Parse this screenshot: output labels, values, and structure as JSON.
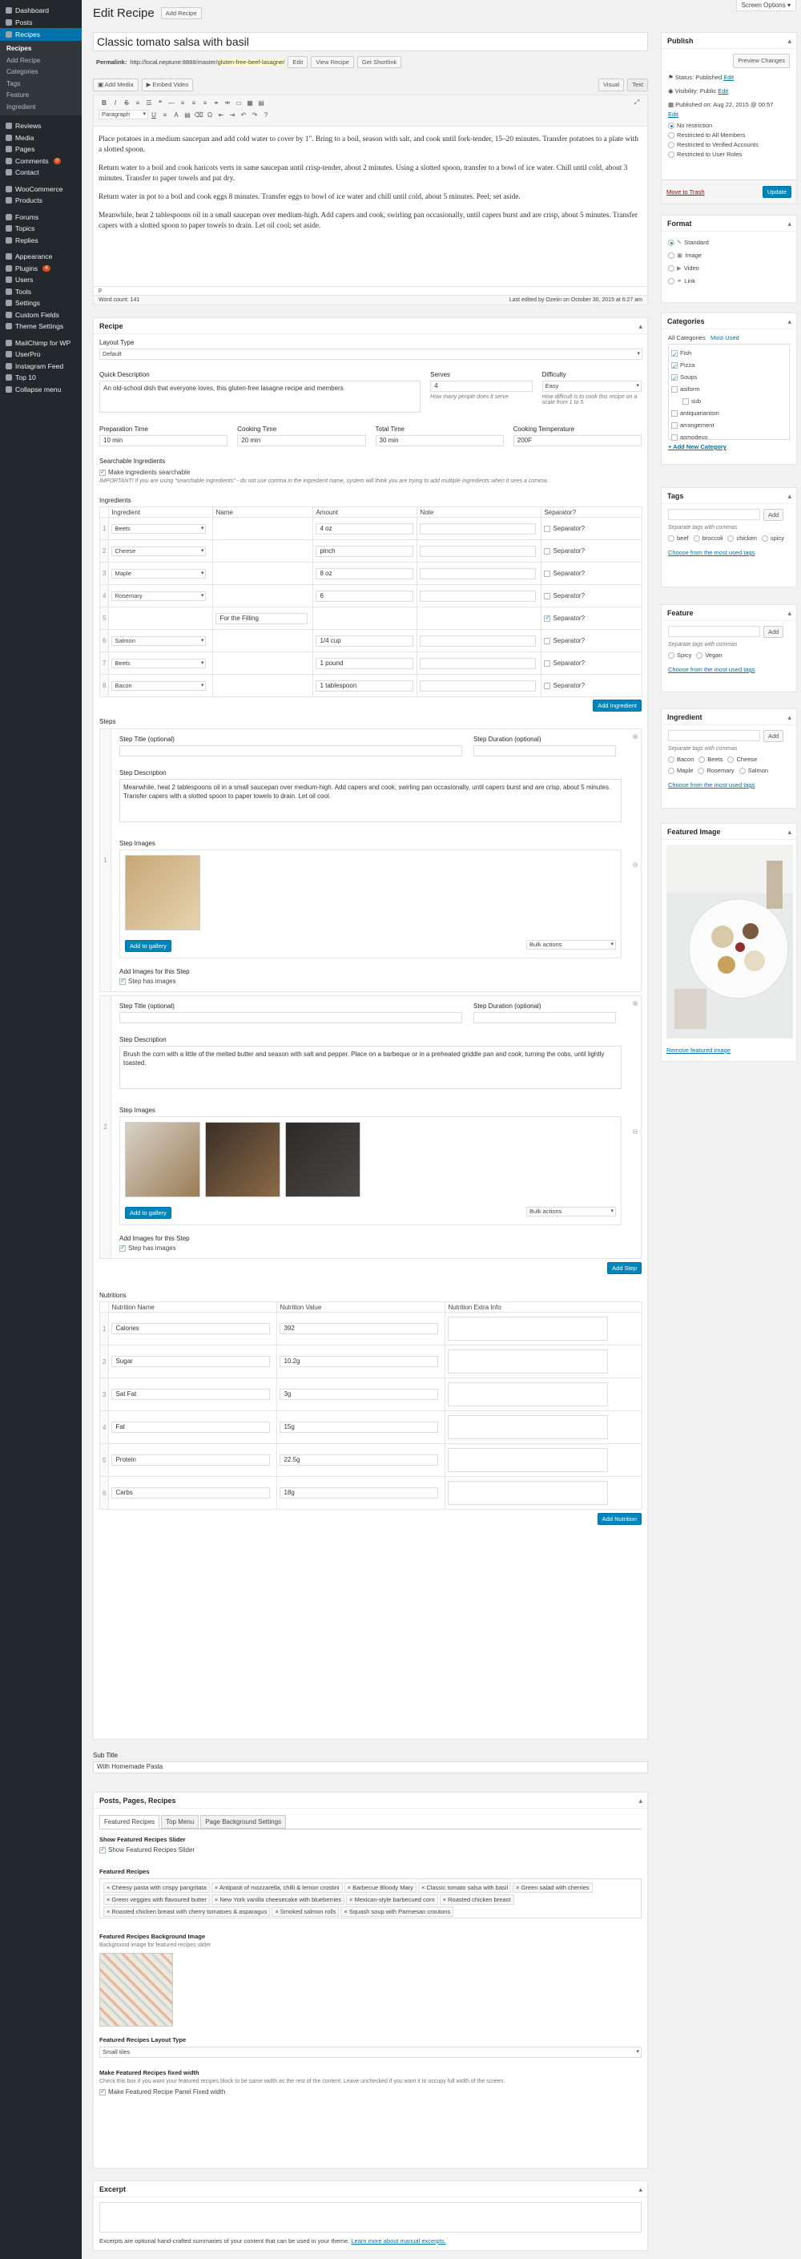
{
  "admin_menu": {
    "items": [
      {
        "label": "Dashboard",
        "icon": "dashboard-icon"
      },
      {
        "label": "Posts",
        "icon": "posts-icon"
      },
      {
        "label": "Recipes",
        "icon": "recipes-icon"
      }
    ],
    "recipes_sub": [
      "Recipes",
      "Add Recipe",
      "Categories",
      "Tags",
      "Feature",
      "Ingredient"
    ],
    "items2": [
      {
        "label": "Reviews"
      },
      {
        "label": "Media"
      },
      {
        "label": "Pages"
      },
      {
        "label": "Comments",
        "badge": "0"
      },
      {
        "label": "Contact"
      }
    ],
    "items3": [
      {
        "label": "WooCommerce"
      },
      {
        "label": "Products"
      }
    ],
    "items4": [
      {
        "label": "Forums"
      },
      {
        "label": "Topics"
      },
      {
        "label": "Replies"
      }
    ],
    "items5": [
      {
        "label": "Appearance"
      },
      {
        "label": "Plugins",
        "badge": "4"
      },
      {
        "label": "Users"
      },
      {
        "label": "Tools"
      },
      {
        "label": "Settings"
      },
      {
        "label": "Custom Fields"
      },
      {
        "label": "Theme Settings"
      }
    ],
    "items6": [
      {
        "label": "MailChimp for WP"
      },
      {
        "label": "UserPro"
      },
      {
        "label": "Instagram Feed"
      },
      {
        "label": "Top 10"
      },
      {
        "label": "Collapse menu"
      }
    ]
  },
  "screen_options": "Screen Options ▾",
  "header": {
    "title": "Edit Recipe",
    "add_btn": "Add Recipe"
  },
  "post": {
    "title": "Classic tomato salsa with basil",
    "permalink_label": "Permalink:",
    "permalink_base": "http://local.neptune:8888/master/",
    "permalink_slug": "gluten-free-beef-lasagne/",
    "edit_btn": "Edit",
    "view_btn": "View Recipe",
    "shortlink_btn": "Get Shortlink"
  },
  "editor": {
    "add_media": "Add Media",
    "embed_video": "Embed Video",
    "visual_tab": "Visual",
    "text_tab": "Text",
    "format_select": "Paragraph",
    "paragraphs": [
      "Place potatoes in a medium saucepan and add cold water to cover by 1\". Bring to a boil, season with salt, and cook until fork-tender, 15–20 minutes. Transfer potatoes to a plate with a slotted spoon.",
      "Return water to a boil and cook haricots verts in same saucepan until crisp-tender, about 2 minutes. Using a slotted spoon, transfer to a bowl of ice water. Chill until cold, about 3 minutes. Transfer to paper towels and pat dry.",
      "Return water in pot to a boil and cook eggs 8 minutes. Transfer eggs to bowl of ice water and chill until cold, about 5 minutes. Peel; set aside.",
      "Meanwhile, heat 2 tablespoons oil in a small saucepan over medium-high. Add capers and cook, swirling pan occasionally, until capers burst and are crisp, about 5 minutes. Transfer capers with a slotted spoon to paper towels to drain. Let oil cool; set aside."
    ],
    "path": "p",
    "word_count": "Word count: 141",
    "last_edited": "Last edited by Ozeiin on October 30, 2015 at 6:27 am"
  },
  "recipe": {
    "title": "Recipe",
    "layout_label": "Layout Type",
    "layout_value": "Default",
    "quick_desc_label": "Quick Description",
    "quick_desc_value": "An old-school dish that everyone loves, this gluten-free lasagne recipe and members",
    "serves_label": "Serves",
    "serves_value": "4",
    "serves_help": "How many people does it serve",
    "difficulty_label": "Difficulty",
    "difficulty_value": "Easy",
    "difficulty_help": "How difficult is to cook this recipe on a scale from 1 to 5",
    "prep_label": "Preparation Time",
    "prep_value": "10 min",
    "cook_label": "Cooking Time",
    "cook_value": "20 min",
    "total_label": "Total Time",
    "total_value": "30 min",
    "temp_label": "Cooking Temperature",
    "temp_value": "200F",
    "searchable_label": "Searchable Ingredients",
    "searchable_cb": "Make ingredients searchable",
    "searchable_note": "IMPORTANT! If you are using \"searchable ingredients\" - do not use comma in the ingredient name, system will think you are trying to add multiple ingredients when it sees a comma.",
    "ingredients_label": "Ingredients",
    "ing_cols": [
      "Ingredient",
      "Name",
      "Amount",
      "Note",
      "Separator?"
    ],
    "ingredients": [
      {
        "n": "1",
        "ingredient": "Beets",
        "name": "",
        "amount": "4 oz",
        "note": "",
        "sep": false
      },
      {
        "n": "2",
        "ingredient": "Cheese",
        "name": "",
        "amount": "pinch",
        "note": "",
        "sep": false
      },
      {
        "n": "3",
        "ingredient": "Maple",
        "name": "",
        "amount": "8 oz",
        "note": "",
        "sep": false
      },
      {
        "n": "4",
        "ingredient": "Rosemary",
        "name": "",
        "amount": "6",
        "note": "",
        "sep": false
      },
      {
        "n": "5",
        "ingredient": "",
        "name": "For the Filling",
        "amount": "",
        "note": "",
        "sep": true
      },
      {
        "n": "6",
        "ingredient": "Salmon",
        "name": "",
        "amount": "1/4 cup",
        "note": "",
        "sep": false
      },
      {
        "n": "7",
        "ingredient": "Beets",
        "name": "",
        "amount": "1 pound",
        "note": "",
        "sep": false
      },
      {
        "n": "8",
        "ingredient": "Bacon",
        "name": "",
        "amount": "1 tablespoon",
        "note": "",
        "sep": false
      }
    ],
    "sep_label": "Separator?",
    "add_ingredient": "Add Ingredient",
    "steps_label": "Steps",
    "step_title_label": "Step Title (optional)",
    "step_duration_label": "Step Duration (optional)",
    "step_desc_label": "Step Description",
    "step_images_label": "Step Images",
    "add_gallery": "Add to gallery",
    "bulk_actions": "Bulk actions",
    "add_images_label": "Add Images for this Step",
    "step_has_images": "Step has images",
    "steps": [
      {
        "n": "1",
        "desc": "Meanwhile, heat 2 tablespoons oil in a small saucepan over medium-high. Add capers and cook, swirling pan occasionally, until capers burst and are crisp, about 5 minutes. Transfer capers with a slotted spoon to paper towels to drain. Let oil cool."
      },
      {
        "n": "2",
        "desc": "Brush the corn with a little of the melted butter and season with salt and pepper. Place on a barbeque or in a preheated griddle pan and cook, turning the cobs, until lightly toasted."
      }
    ],
    "add_step": "Add Step",
    "nutritions_label": "Nutritions",
    "nut_cols": [
      "Nutrition Name",
      "Nutrition Value",
      "Nutrition Extra Info"
    ],
    "nutritions": [
      {
        "n": "1",
        "name": "Calories",
        "value": "392"
      },
      {
        "n": "2",
        "name": "Sugar",
        "value": "10.2g"
      },
      {
        "n": "3",
        "name": "Sat Fat",
        "value": "3g"
      },
      {
        "n": "4",
        "name": "Fat",
        "value": "15g"
      },
      {
        "n": "5",
        "name": "Protein",
        "value": "22.5g"
      },
      {
        "n": "6",
        "name": "Carbs",
        "value": "18g"
      }
    ],
    "add_nutrition": "Add Nutrition"
  },
  "subtitle": {
    "label": "Sub Title",
    "value": "With Homemade Pasta"
  },
  "ppr": {
    "title": "Posts, Pages, Recipes",
    "tabs": [
      "Featured Recipes",
      "Top Menu",
      "Page Background Settings"
    ],
    "show_slider_label": "Show Featured Recipes Slider",
    "show_slider_cb": "Show Featured Recipes Slider",
    "featured_label": "Featured Recipes",
    "featured": [
      "Cheesy pasta with crispy pangritata",
      "Antipasti of mozzarella, chilli & lemon crostini",
      "Barbecue Bloody Mary",
      "Classic tomato salsa with basil",
      "Green salad with cherries",
      "Green veggies with flavoured butter",
      "New York vanilla cheesecake with blueberries",
      "Mexican-style barbecued corn",
      "Roasted chicken breast",
      "Roasted chicken breast with cherry tomatoes & asparagus",
      "Smoked salmon rolls",
      "Squash soup with Parmesan croutons"
    ],
    "bg_label": "Featured Recipes Background Image",
    "bg_help": "Background image for featured recipes slider",
    "layout_label": "Featured Recipes Layout Type",
    "layout_value": "Small tiles",
    "fixed_label": "Make Featured Recipes fixed width",
    "fixed_help": "Check this box if you want your featured recipes block to be same width as the rest of the content. Leave unchecked if you want it to occupy full width of the screen.",
    "fixed_cb": "Make Featured Recipe Panel Fixed width"
  },
  "excerpt": {
    "title": "Excerpt",
    "help": "Excerpts are optional hand-crafted summaries of your content that can be used in your theme.",
    "help_link": "Learn more about manual excerpts."
  },
  "publish": {
    "title": "Publish",
    "preview": "Preview Changes",
    "status": "Status: Published",
    "status_edit": "Edit",
    "visibility": "Visibility: Public",
    "visibility_edit": "Edit",
    "published_on": "Published on: Aug 22, 2015 @ 00:57",
    "published_edit": "Edit",
    "options": [
      {
        "label": "No restriction",
        "on": true
      },
      {
        "label": "Restricted to All Members",
        "on": false
      },
      {
        "label": "Restricted to Verified Accounts",
        "on": false
      },
      {
        "label": "Restricted to User Roles",
        "on": false
      }
    ],
    "trash": "Move to Trash",
    "update": "Update"
  },
  "format": {
    "title": "Format",
    "options": [
      {
        "label": "Standard",
        "on": true
      },
      {
        "label": "Image",
        "on": false
      },
      {
        "label": "Video",
        "on": false
      },
      {
        "label": "Link",
        "on": false
      }
    ]
  },
  "categories": {
    "title": "Categories",
    "tab_all": "All Categories",
    "tab_used": "Most Used",
    "items": [
      {
        "label": "Fish",
        "on": true,
        "indent": false
      },
      {
        "label": "Pizza",
        "on": true,
        "indent": false
      },
      {
        "label": "Soups",
        "on": true,
        "indent": false
      },
      {
        "label": "asiform",
        "on": false,
        "indent": false
      },
      {
        "label": "sub",
        "on": false,
        "indent": true
      },
      {
        "label": "antiquarianism",
        "on": false,
        "indent": false
      },
      {
        "label": "arrangement",
        "on": false,
        "indent": false
      },
      {
        "label": "asmodeus",
        "on": false,
        "indent": false
      }
    ],
    "add_new": "+ Add New Category"
  },
  "tags": {
    "title": "Tags",
    "add": "Add",
    "help": "Separate tags with commas",
    "items": [
      "beef",
      "broccoli",
      "chicken",
      "spicy"
    ],
    "choose": "Choose from the most used tags"
  },
  "feature": {
    "title": "Feature",
    "add": "Add",
    "help": "Separate tags with commas",
    "items": [
      "Spicy",
      "Vegan"
    ],
    "choose": "Choose from the most used tags"
  },
  "ingredient_box": {
    "title": "Ingredient",
    "add": "Add",
    "help": "Separate tags with commas",
    "items": [
      "Bacon",
      "Beets",
      "Cheese",
      "Maple",
      "Rosemary",
      "Salmon"
    ],
    "choose": "Choose from the most used tags"
  },
  "featured_image": {
    "title": "Featured Image",
    "remove": "Remove featured image"
  },
  "colors": {
    "primary": "#0085ba",
    "sidebar": "#23282d",
    "active": "#0073aa",
    "trash": "#a00"
  }
}
